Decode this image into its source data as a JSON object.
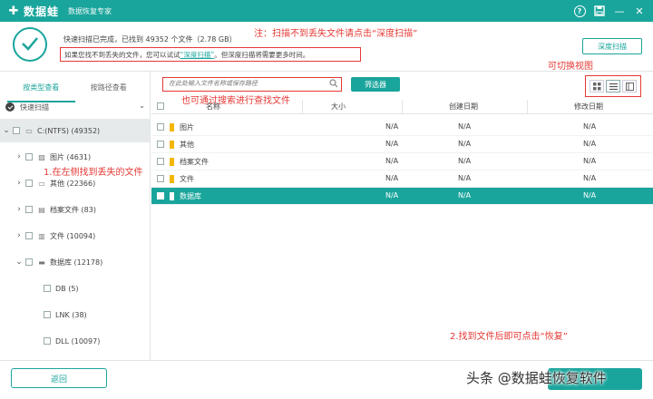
{
  "app": {
    "logo_text": "数据蛙",
    "subtitle": "数据恢复专家"
  },
  "header": {
    "scan_status": "快速扫描已完成，已找到 49352 个文件（2.78 GB）",
    "hint_prefix": "如果您找不到丢失的文件，您可以试试",
    "hint_link": "“深度扫描”",
    "hint_suffix": "。但深度扫描将需要更多时间。",
    "deep_scan_button": "深度扫描"
  },
  "annotations": {
    "note_deep_scan": "注：扫描不到丢失文件请点击“深度扫描”",
    "switch_view": "可切换视图",
    "search_tip": "也可通过搜索进行查找文件",
    "left_tip": "1.在左侧找到丢失的文件",
    "recover_tip": "2.找到文件后即可点击“恢复”"
  },
  "sidebar": {
    "tab_by_type": "按类型查看",
    "tab_by_path": "按路径查看",
    "quick_scan": "快速扫描",
    "drive": "C:(NTFS) (49352)",
    "items": [
      {
        "label": "图片 (4631)"
      },
      {
        "label": "其他 (22366)"
      },
      {
        "label": "档案文件 (83)"
      },
      {
        "label": "文件 (10094)"
      },
      {
        "label": "数据库 (12178)"
      }
    ],
    "subitems": [
      {
        "label": "DB (5)"
      },
      {
        "label": "LNK (38)"
      },
      {
        "label": "DLL (10097)"
      }
    ]
  },
  "toolbar": {
    "search_placeholder": "在此处输入文件名称或保存路径",
    "filter_button": "筛选器"
  },
  "table": {
    "columns": [
      "名称",
      "大小",
      "创建日期",
      "修改日期"
    ],
    "rows": [
      {
        "name": "图片",
        "size": "N/A",
        "created": "N/A",
        "modified": "N/A"
      },
      {
        "name": "其他",
        "size": "N/A",
        "created": "N/A",
        "modified": "N/A"
      },
      {
        "name": "档案文件",
        "size": "N/A",
        "created": "N/A",
        "modified": "N/A"
      },
      {
        "name": "文件",
        "size": "N/A",
        "created": "N/A",
        "modified": "N/A"
      },
      {
        "name": "数据库",
        "size": "N/A",
        "created": "N/A",
        "modified": "N/A"
      }
    ]
  },
  "footer": {
    "back_button": "返回",
    "watermark": "头条 @数据蛙恢复软件"
  },
  "colors": {
    "accent": "#1aa59c",
    "annotation": "#e53935"
  }
}
